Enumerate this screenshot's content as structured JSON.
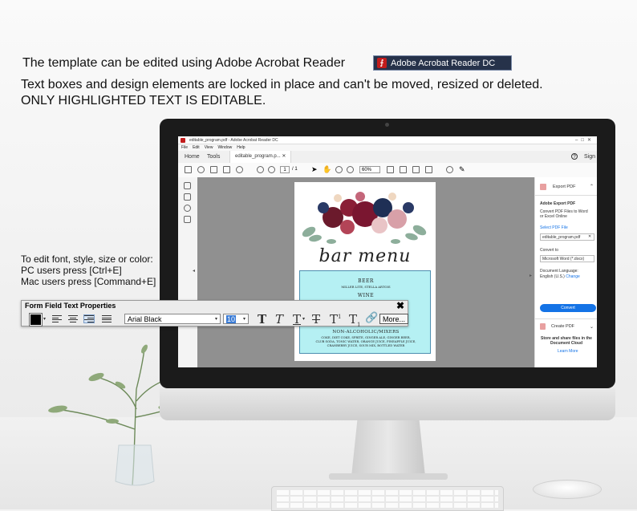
{
  "header": {
    "line1": "The template can be edited using Adobe Acrobat Reader",
    "badge_label": "Adobe Acrobat Reader DC",
    "line2": "Text boxes and design elements are locked in place and can't be moved, resized or deleted.",
    "line3": "ONLY HIGHLIGHTED TEXT IS EDITABLE."
  },
  "instructions": {
    "line1": "To edit font, style, size or color:",
    "line2": "PC users press [Ctrl+E]",
    "line3": "Mac users press [Command+E]"
  },
  "acrobat": {
    "window_title": "editable_program.pdf - Adobe Acrobat Reader DC",
    "menu": [
      "File",
      "Edit",
      "View",
      "Window",
      "Help"
    ],
    "tabs": {
      "home": "Home",
      "tools": "Tools",
      "doc": "editable_program.p..."
    },
    "sign_in": "Sign",
    "page_current": "1",
    "page_total": "/ 1",
    "zoom": "60%",
    "right_panel": {
      "export_pdf": "Export PDF",
      "adobe_export_pdf": "Adobe Export PDF",
      "desc": "Convert PDF Files to Word or Excel Online",
      "select_pdf": "Select PDF File",
      "file_name": "editable_program.pdf",
      "convert_to": "Convert to",
      "format": "Microsoft Word (*.docx)",
      "doc_language": "Document Language:",
      "language": "English (U.S.)",
      "change": "Change",
      "convert_button": "Convert",
      "create_pdf": "Create PDF",
      "cloud_desc": "Store and share files in the Document Cloud",
      "learn_more": "Learn More"
    }
  },
  "menu_page": {
    "title": "bar menu",
    "beer_heading": "BEER",
    "beer_items": "MILLER LITE, STELLA ARTOIS",
    "wine_heading": "WINE",
    "na_heading": "NON-ALCOHOLIC/MIXERS",
    "na_items_1": "COKE, DIET COKE, SPRITE, GINGER ALE, GINGER BEER,",
    "na_items_2": "CLUB SODA, TONIC WATER, ORANGE JUICE, PINEAPPLE JUICE,",
    "na_items_3": "CRANBERRY JUICE, SOUR MIX, BOTTLED WATER"
  },
  "form_field_props": {
    "title": "Form Field Text Properties",
    "font": "Arial Black",
    "size": "10",
    "more_button": "More...",
    "color": "#000000"
  },
  "colors": {
    "highlight": "#b5f0f3",
    "acrobat_red": "#c21c1c",
    "convert_blue": "#1473e6"
  }
}
